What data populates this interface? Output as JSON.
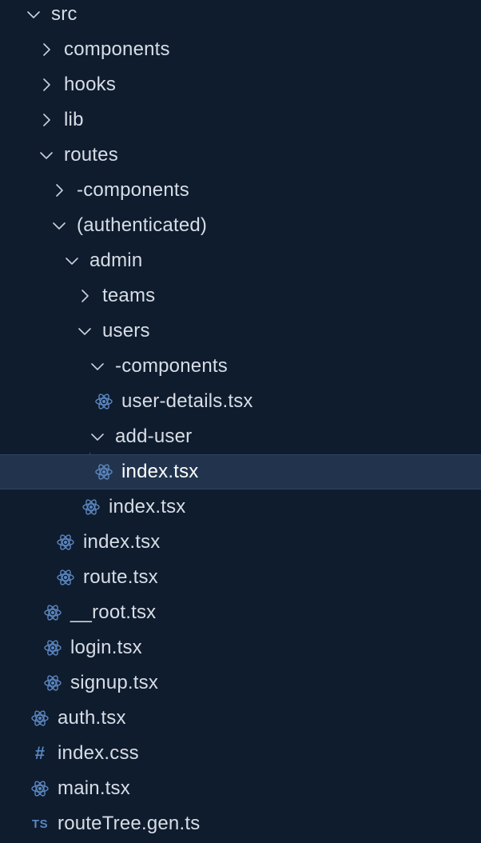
{
  "explorer": {
    "colors": {
      "background": "#0f1c2d",
      "text": "#d7dde6",
      "selected_background": "#22344d",
      "icon_blue": "#5b87c1"
    },
    "items": [
      {
        "label": "src",
        "type": "folder",
        "expanded": true,
        "depth": 0
      },
      {
        "label": "components",
        "type": "folder",
        "expanded": false,
        "depth": 1
      },
      {
        "label": "hooks",
        "type": "folder",
        "expanded": false,
        "depth": 1
      },
      {
        "label": "lib",
        "type": "folder",
        "expanded": false,
        "depth": 1
      },
      {
        "label": "routes",
        "type": "folder",
        "expanded": true,
        "depth": 1
      },
      {
        "label": "-components",
        "type": "folder",
        "expanded": false,
        "depth": 2
      },
      {
        "label": "(authenticated)",
        "type": "folder",
        "expanded": true,
        "depth": 2
      },
      {
        "label": "admin",
        "type": "folder",
        "expanded": true,
        "depth": 3
      },
      {
        "label": "teams",
        "type": "folder",
        "expanded": false,
        "depth": 4
      },
      {
        "label": "users",
        "type": "folder",
        "expanded": true,
        "depth": 4
      },
      {
        "label": "-components",
        "type": "folder",
        "expanded": true,
        "depth": 5
      },
      {
        "label": "user-details.tsx",
        "type": "react",
        "depth": 6
      },
      {
        "label": "add-user",
        "type": "folder",
        "expanded": true,
        "depth": 5
      },
      {
        "label": "index.tsx",
        "type": "react",
        "depth": 6,
        "selected": true
      },
      {
        "label": "index.tsx",
        "type": "react",
        "depth": 5
      },
      {
        "label": "index.tsx",
        "type": "react",
        "depth": 3
      },
      {
        "label": "route.tsx",
        "type": "react",
        "depth": 3
      },
      {
        "label": "__root.tsx",
        "type": "react",
        "depth": 2
      },
      {
        "label": "login.tsx",
        "type": "react",
        "depth": 2
      },
      {
        "label": "signup.tsx",
        "type": "react",
        "depth": 2
      },
      {
        "label": "auth.tsx",
        "type": "react",
        "depth": 1
      },
      {
        "label": "index.css",
        "type": "css",
        "depth": 1,
        "icon_text": "#"
      },
      {
        "label": "main.tsx",
        "type": "react",
        "depth": 1
      },
      {
        "label": "routeTree.gen.ts",
        "type": "ts",
        "depth": 1,
        "icon_text": "TS"
      }
    ]
  }
}
